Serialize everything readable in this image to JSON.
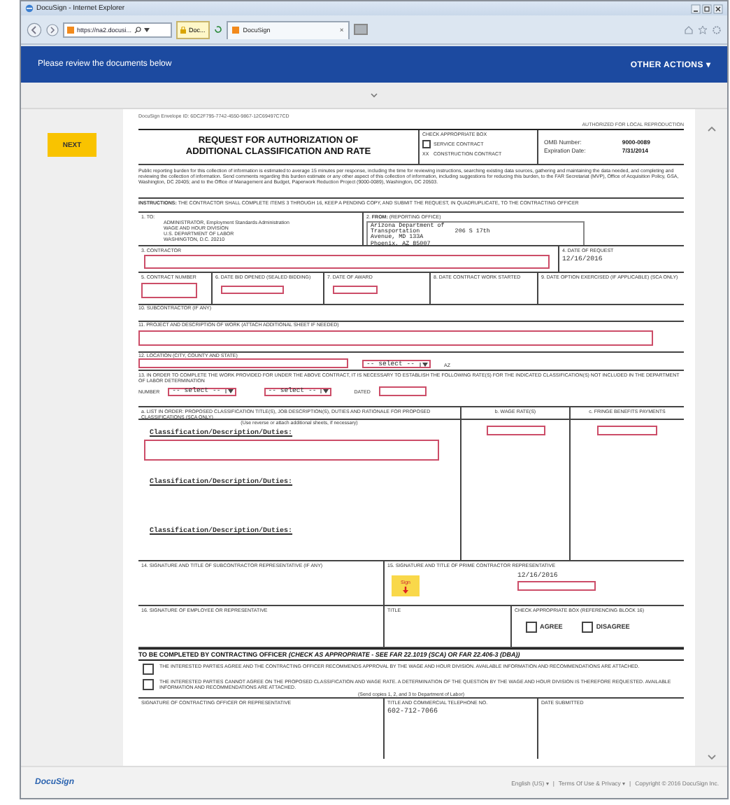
{
  "window": {
    "title": "DocuSign - Internet Explorer"
  },
  "browser": {
    "address": "https://na2.docusi...",
    "site": "Doc...",
    "tab": {
      "label": "DocuSign",
      "selected": true,
      "close": "×"
    }
  },
  "banner": {
    "message": "Please review the documents below",
    "actions": "OTHER ACTIONS ▾"
  },
  "next_button": "NEXT",
  "document": {
    "envelope_id": "DocuSign Envelope ID: 6DC2F795-7742-4550-9867-12C69497C7CD",
    "authorized": "AUTHORIZED FOR LOCAL REPRODUCTION",
    "title": "REQUEST FOR AUTHORIZATION OF ADDITIONAL CLASSIFICATION AND RATE",
    "contract_type": {
      "heading": "CHECK APPROPRIATE BOX",
      "options": [
        {
          "label": "SERVICE CONTRACT",
          "checked": false
        },
        {
          "label": "CONSTRUCTION CONTRACT",
          "checked": true,
          "mark_text": "XX"
        }
      ]
    },
    "omb": {
      "number_label": "OMB Number:",
      "number": "9000-0089",
      "expiration_label": "Expiration Date:",
      "expiration": "7/31/2014"
    },
    "burden_notice": "Public reporting burden for this collection of information is estimated to average 15 minutes per response, including the time for reviewing instructions, searching existing data sources, gathering and maintaining the data needed, and completing and reviewing the collection of information. Send comments regarding this burden estimate or any other aspect of this collection of information, including suggestions for reducing this burden, to the FAR Secretariat (MVP), Office of Acquisition Policy, GSA, Washington, DC 20405; and to the Office of Management and Budget, Paperwork Reduction Project (9000-0089), Washington, DC 20503.",
    "instructions": "**INSTRUCTIONS:** THE CONTRACTOR SHALL COMPLETE ITEMS 3 THROUGH 16, KEEP A PENDING COPY, AND SUBMIT THE REQUEST, IN QUADRUPLICATE, TO THE CONTRACTING OFFICER",
    "to": {
      "label": "1. TO:",
      "lines": [
        "ADMINISTRATOR, Employment Standards Administration",
        "WAGE AND HOUR DIVISION",
        "U.S. DEPARTMENT OF LABOR",
        "WASHINGTON, D.C. 20210"
      ]
    },
    "from": {
      "label": "2. **FROM:** (REPORTING OFFICE)",
      "lines": [
        "Arizona Department of",
        "Transportation          206 S 17th",
        "Avenue, MD 133A",
        "Phoenix, AZ 85007"
      ]
    },
    "contractor": {
      "label": "3. CONTRACTOR"
    },
    "date_of_request": {
      "label": "4. DATE OF REQUEST",
      "value": "12/16/2016"
    },
    "contract_dates": [
      {
        "label": "5. CONTRACT NUMBER",
        "kind": "input"
      },
      {
        "label": "6. DATE BID OPENED (SEALED BIDDING)",
        "kind": "input"
      },
      {
        "label": "7. DATE OF AWARD",
        "kind": "input"
      },
      {
        "label": "8. DATE CONTRACT WORK STARTED",
        "kind": "plain"
      },
      {
        "label": "9. DATE OPTION EXERCISED (IF APPLICABLE) (SCA ONLY)",
        "kind": "plain"
      }
    ],
    "subcontractor": {
      "label": "10. SUBCONTRACTOR (IF ANY)"
    },
    "project": {
      "label": "11. PROJECT AND DESCRIPTION OF WORK (ATTACH ADDITIONAL SHEET IF NEEDED)"
    },
    "location": {
      "label": "12. LOCATION (CITY, COUNTY AND STATE)",
      "county_select": "-- select --",
      "state": "AZ"
    },
    "determination": {
      "label": "13. IN ORDER TO COMPLETE THE WORK PROVIDED FOR UNDER THE ABOVE CONTRACT, IT IS NECESSARY TO ESTABLISH THE FOLLOWING RATE(S) FOR THE INDICATED CLASSIFICATION(S) NOT INCLUDED IN THE DEPARTMENT OF LABOR DETERMINATION",
      "number_label": "NUMBER",
      "number_selects": [
        "-- select --",
        "-- select --"
      ],
      "dated_label": "DATED"
    },
    "classifications": {
      "columns": [
        "a. LIST IN ORDER: PROPOSED CLASSIFICATION TITLE(S), JOB DESCRIPTION(S), DUTIES AND RATIONALE FOR PROPOSED CLASSIFICATIONS (SCA ONLY)",
        "b. WAGE RATE(S)",
        "c. FRINGE BENEFITS PAYMENTS"
      ],
      "note": "(Use reverse or attach additional sheets, if necessary)",
      "entries": [
        {
          "heading": "Classification/Description/Duties:",
          "kind": "input"
        },
        {
          "heading": "Classification/Description/Duties:",
          "kind": "plain"
        },
        {
          "heading": "Classification/Description/Duties:",
          "kind": "plain"
        }
      ]
    },
    "signatures": {
      "subcontractor": "14. SIGNATURE AND TITLE OF SUBCONTRACTOR REPRESENTATIVE (IF ANY)",
      "prime": "15. SIGNATURE AND TITLE OF PRIME CONTRACTOR REPRESENTATIVE",
      "sign_tag": "Sign",
      "prime_date": "12/16/2016",
      "employee": "16. SIGNATURE OF EMPLOYEE OR REPRESENTATIVE",
      "title": "TITLE",
      "check_heading": "CHECK APPROPRIATE BOX (REFERENCING BLOCK 16)",
      "choices": [
        {
          "label": "AGREE",
          "checked": false
        },
        {
          "label": "DISAGREE",
          "checked": false
        }
      ]
    },
    "officer": {
      "heading": "TO BE COMPLETED BY CONTRACTING OFFICER *(CHECK AS APPROPRIATE - SEE FAR 22.1019 (SCA) OR FAR 22.406-3 (DBA))*",
      "options": [
        {
          "text": "THE INTERESTED PARTIES AGREE AND THE CONTRACTING OFFICER RECOMMENDS APPROVAL BY THE WAGE AND HOUR DIVISION.  AVAILABLE INFORMATION AND RECOMMENDATIONS ARE ATTACHED.",
          "checked": false
        },
        {
          "text": "THE INTERESTED PARTIES CANNOT AGREE ON THE PROPOSED CLASSIFICATION AND WAGE RATE.  A DETERMINATION OF THE QUESTION BY THE WAGE AND HOUR DIVISION IS THEREFORE REQUESTED.  AVAILABLE INFORMATION AND RECOMMENDATIONS ARE ATTACHED.",
          "checked": false
        }
      ],
      "copies_note": "(Send copies 1, 2, and 3 to Department of Labor)",
      "signature_label": "SIGNATURE OF CONTRACTING OFFICER OR REPRESENTATIVE",
      "phone_label": "TITLE AND COMMERCIAL TELEPHONE NO.",
      "phone": "602-712-7066",
      "date_label": "DATE SUBMITTED"
    }
  },
  "footer": {
    "logo": "DocuSign",
    "links": [
      "English (US) ▾",
      "Terms Of Use & Privacy ▾"
    ],
    "separators": [
      "|",
      "|"
    ],
    "copyright": "Copyright © 2016 DocuSign Inc."
  }
}
